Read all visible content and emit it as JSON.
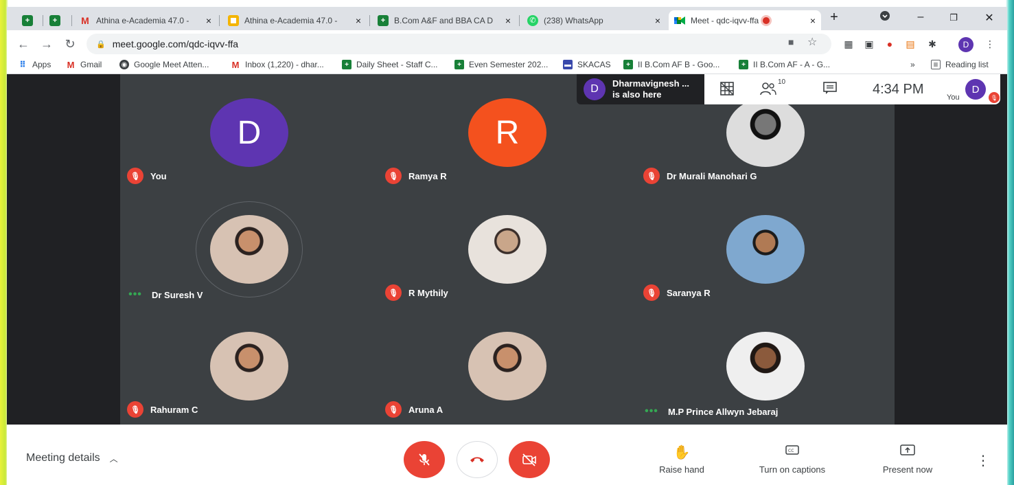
{
  "browser": {
    "tabs": [
      {
        "title": "",
        "icon": "sheets-icon"
      },
      {
        "title": "",
        "icon": "sheets-icon"
      },
      {
        "title": "Athina e-Academia 47.0 - ",
        "icon": "gmail-icon"
      },
      {
        "title": "Athina e-Academia 47.0 - ",
        "icon": "slides-icon"
      },
      {
        "title": "B.Com A&F and BBA CA D",
        "icon": "sheets-icon"
      },
      {
        "title": "(238) WhatsApp",
        "icon": "whatsapp-icon"
      },
      {
        "title": "Meet - qdc-iqvv-ffa",
        "icon": "meet-icon"
      }
    ],
    "new_tab": "+",
    "close_glyph": "×",
    "url": "meet.google.com/qdc-iqvv-ffa",
    "profile_initial": "D",
    "bookmarks": [
      {
        "label": "Apps"
      },
      {
        "label": "Gmail"
      },
      {
        "label": "Google Meet Atten..."
      },
      {
        "label": "Inbox (1,220) - dhar..."
      },
      {
        "label": "Daily Sheet - Staff C..."
      },
      {
        "label": "Even Semester 202..."
      },
      {
        "label": "SKACAS"
      },
      {
        "label": "II B.Com AF B - Goo..."
      },
      {
        "label": "II B.Com AF - A - G..."
      }
    ],
    "bookmarks_more": "»",
    "reading_list": "Reading list"
  },
  "meet": {
    "presence": {
      "initial": "D",
      "name": "Dharmavignesh ...",
      "sub": "is also here"
    },
    "participant_count": "10",
    "time": "4:34 PM",
    "self_label": "You",
    "self_initial": "D",
    "participants": [
      {
        "name": "You",
        "initial": "D",
        "color": "#5e35b1",
        "muted": true
      },
      {
        "name": "Ramya R",
        "initial": "R",
        "color": "#f4511e",
        "muted": true
      },
      {
        "name": "Dr Murali Manohari G",
        "muted": true
      },
      {
        "name": "Dr Suresh V",
        "muted": false
      },
      {
        "name": "R Mythily",
        "muted": true
      },
      {
        "name": "Saranya R",
        "muted": true
      },
      {
        "name": "Rahuram C",
        "muted": true
      },
      {
        "name": "Aruna A",
        "muted": true
      },
      {
        "name": "M.P Prince Allwyn Jebaraj",
        "muted": false
      }
    ],
    "bottom": {
      "meeting_details": "Meeting details",
      "raise_hand": "Raise hand",
      "captions": "Turn on captions",
      "present": "Present now"
    },
    "colors": {
      "accent_red": "#ea4335",
      "stage_bg": "#3c4043",
      "avatar_purple": "#5e35b1",
      "avatar_orange": "#f4511e"
    }
  }
}
